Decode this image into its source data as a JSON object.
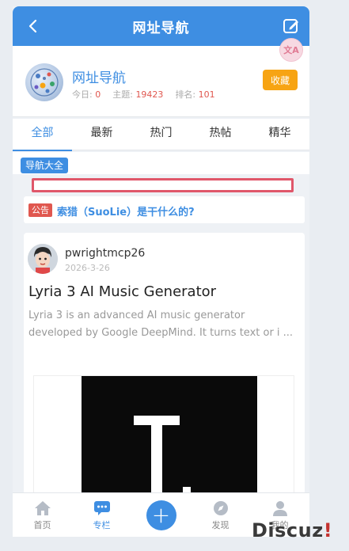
{
  "header": {
    "title": "网址导航"
  },
  "translate_badge": {
    "glyph": "文A"
  },
  "forum": {
    "name": "网址导航",
    "today_label": "今日:",
    "today_value": "0",
    "topics_label": "主题:",
    "topics_value": "19423",
    "rank_label": "排名:",
    "rank_value": "101",
    "favorite_label": "收藏"
  },
  "tabs": [
    {
      "label": "全部"
    },
    {
      "label": "最新"
    },
    {
      "label": "热门"
    },
    {
      "label": "热帖"
    },
    {
      "label": "精华"
    }
  ],
  "subcategory": {
    "label": "导航大全"
  },
  "announcement": {
    "tag": "公告",
    "text": "索猎（SuoLie）是干什么的?"
  },
  "post": {
    "author": "pwrightmcp26",
    "date": "2026-3-26",
    "title": "Lyria 3 AI Music Generator",
    "excerpt": "Lyria 3 is an advanced AI music generator developed by Google DeepMind. It turns text or i ..."
  },
  "bottom_nav": [
    {
      "label": "首页",
      "icon": "home-icon"
    },
    {
      "label": "专栏",
      "icon": "chat-icon"
    },
    {
      "label": "",
      "icon": "plus-icon"
    },
    {
      "label": "发现",
      "icon": "compass-icon"
    },
    {
      "label": "我的",
      "icon": "user-icon"
    }
  ],
  "watermark": {
    "text": "Discuz",
    "mark": "!"
  },
  "colors": {
    "primary": "#3e8ee2",
    "accent_orange": "#f7a413",
    "alert_red": "#e0574f",
    "frame_red": "#e0576a"
  }
}
